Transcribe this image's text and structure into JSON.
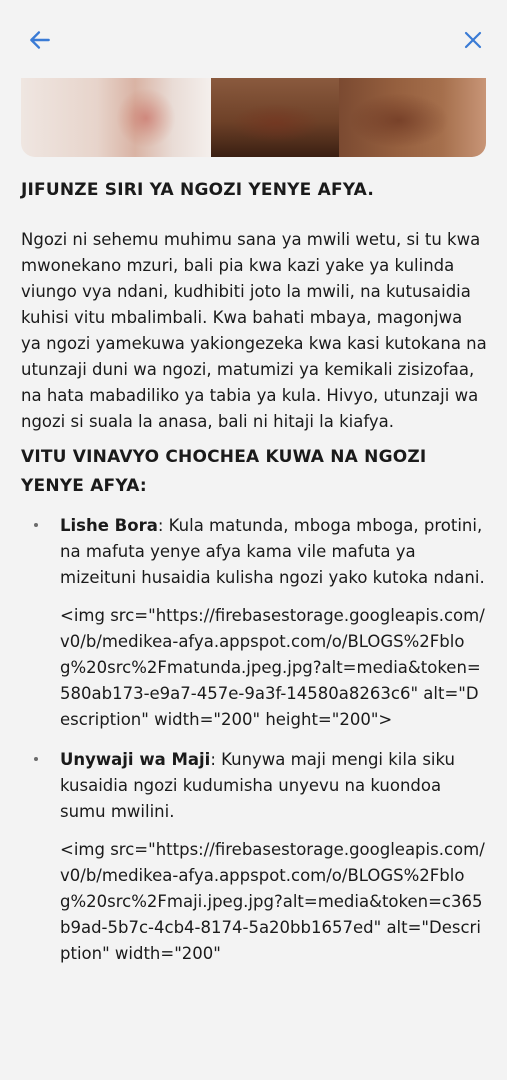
{
  "header": {
    "back_icon": "arrow-left-icon",
    "close_icon": "close-icon",
    "accent_color": "#3a7bd5"
  },
  "hero_image": {
    "description_icon": "skin-conditions-photo"
  },
  "article": {
    "title": "JIFUNZE SIRI YA NGOZI YENYE AFYA.",
    "intro": "Ngozi ni sehemu muhimu sana ya mwili wetu, si tu kwa mwonekano mzuri, bali pia kwa kazi yake ya kulinda viungo vya ndani, kudhibiti joto la mwili, na kutusaidia kuhisi vitu mbalimbali. Kwa bahati mbaya, magonjwa ya ngozi yamekuwa yakiongezeka kwa kasi kutokana na utunzaji duni wa ngozi, matumizi ya kemikali zisizofaa, na hata mabadiliko ya tabia ya kula. Hivyo, utunzaji wa ngozi si suala la anasa, bali ni hitaji la kiafya.",
    "section_heading": "VITU VINAVYO CHOCHEA KUWA NA NGOZI YENYE AFYA:",
    "items": [
      {
        "term": "Lishe Bora",
        "text": ": Kula matunda, mboga mboga, protini, na mafuta yenye afya kama vile mafuta ya mizeituni husaidia kulisha ngozi yako kutoka ndani.",
        "img_code": " <img src=\"https://firebasestorage.googleapis.com/v0/b/medikea-afya.appspot.com/o/BLOGS%2Fblog%20src%2Fmatunda.jpeg.jpg?alt=media&token=580ab173-e9a7-457e-9a3f-14580a8263c6\" alt=\"Description\" width=\"200\" height=\"200\">"
      },
      {
        "term": "Unywaji wa Maji",
        "text": ": Kunywa maji mengi kila siku kusaidia ngozi kudumisha unyevu na kuondoa sumu mwilini.",
        "img_code": " <img src=\"https://firebasestorage.googleapis.com/v0/b/medikea-afya.appspot.com/o/BLOGS%2Fblog%20src%2Fmaji.jpeg.jpg?alt=media&token=c365b9ad-5b7c-4cb4-8174-5a20bb1657ed\" alt=\"Description\" width=\"200\""
      }
    ]
  }
}
